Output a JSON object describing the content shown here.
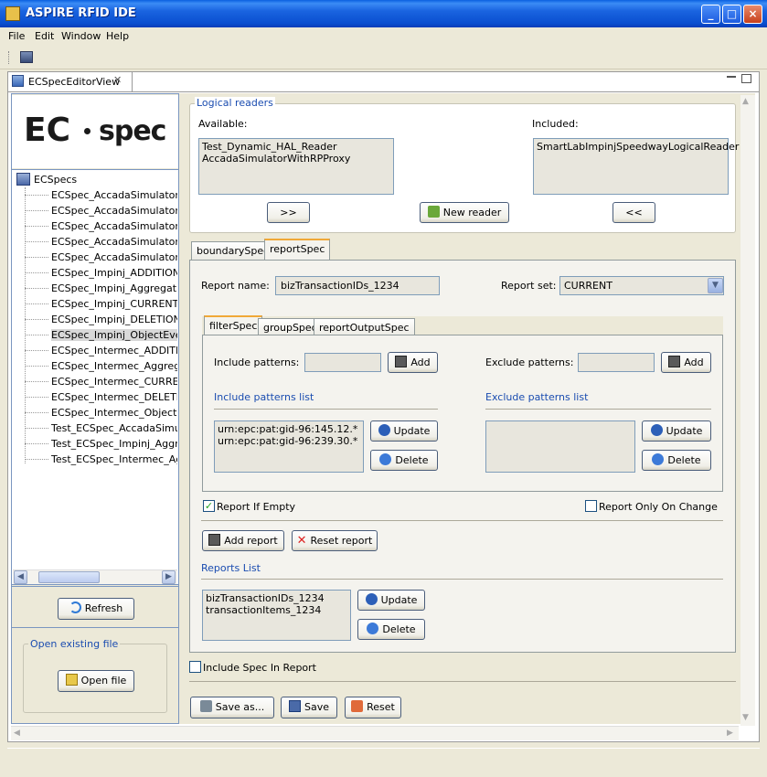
{
  "window": {
    "title": "ASPIRE RFID IDE",
    "min": "_",
    "max": "□",
    "close": "×"
  },
  "menu": [
    "File",
    "Edit",
    "Window",
    "Help"
  ],
  "view_tab": {
    "label": "ECSpecEditorView",
    "close": "✕"
  },
  "logo": {
    "left": "EC",
    "right": "spec"
  },
  "tree": {
    "root": "ECSpecs",
    "items": [
      "ECSpec_AccadaSimulator_AD",
      "ECSpec_AccadaSimulator_Ag",
      "ECSpec_AccadaSimulator_CU",
      "ECSpec_AccadaSimulator_DE",
      "ECSpec_AccadaSimulator_Ol",
      "ECSpec_Impinj_ADDITIONS_",
      "ECSpec_Impinj_Aggregation",
      "ECSpec_Impinj_CURRENT_F",
      "ECSpec_Impinj_DELETIONS_",
      "ECSpec_Impinj_ObjectEvent",
      "ECSpec_Intermec_ADDITION",
      "ECSpec_Intermec_Aggregat",
      "ECSpec_Intermec_CURRENT",
      "ECSpec_Intermec_DELETION",
      "ECSpec_Intermec_ObjectEve",
      "Test_ECSpec_AccadaSimulat",
      "Test_ECSpec_Impinj_Aggreg",
      "Test_ECSpec_Intermec_Agg"
    ],
    "selected_index": 9
  },
  "left_buttons": {
    "refresh": "Refresh"
  },
  "open_existing": {
    "legend": "Open existing file",
    "button": "Open file"
  },
  "logical_readers": {
    "legend": "Logical readers",
    "available_label": "Available:",
    "available": [
      "Test_Dynamic_HAL_Reader",
      "AccadaSimulatorWithRPProxy"
    ],
    "included_label": "Included:",
    "included": [
      "SmartLabImpinjSpeedwayLogicalReader"
    ],
    "add_button": ">>",
    "new_reader_button": "New reader",
    "remove_button": "<<"
  },
  "spec_tabs": [
    "boundarySpec",
    "reportSpec"
  ],
  "report": {
    "name_label": "Report name:",
    "name_value": "bizTransactionIDs_1234",
    "set_label": "Report set:",
    "set_value": "CURRENT"
  },
  "inner_tabs": [
    "filterSpec",
    "groupSpec",
    "reportOutputSpec"
  ],
  "filter": {
    "include_label": "Include patterns:",
    "exclude_label": "Exclude patterns:",
    "add": "Add",
    "include_list_title": "Include patterns list",
    "exclude_list_title": "Exclude patterns list",
    "include_list": [
      "urn:epc:pat:gid-96:145.12.*",
      "urn:epc:pat:gid-96:239.30.*"
    ],
    "exclude_list": [],
    "update": "Update",
    "delete": "Delete"
  },
  "options": {
    "report_if_empty": "Report If Empty",
    "report_if_empty_checked": true,
    "report_only_on_change": "Report Only On Change",
    "report_only_on_change_checked": false
  },
  "report_buttons": {
    "add": "Add report",
    "reset": "Reset report"
  },
  "reports": {
    "title": "Reports List",
    "items": [
      "bizTransactionIDs_1234",
      "transactionItems_1234"
    ],
    "update": "Update",
    "delete": "Delete"
  },
  "include_spec": {
    "label": "Include Spec In Report",
    "checked": false
  },
  "bottom_buttons": {
    "save_as": "Save as...",
    "save": "Save",
    "reset": "Reset"
  },
  "colors": {
    "title_blue": "#0a4fd0",
    "accent_blue": "#1a4cb0",
    "tab_orange": "#f0a838"
  }
}
